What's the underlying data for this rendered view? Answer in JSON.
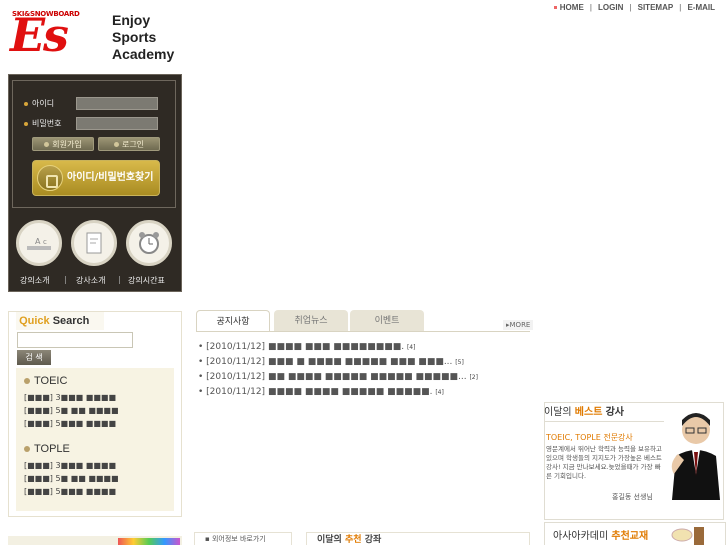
{
  "logo": {
    "sub": "SKI&SNOWBOARD",
    "mark": "Es",
    "line1": "Enjoy",
    "line2": "Sports",
    "line3": "Academy"
  },
  "topnav": [
    "HOME",
    "LOGIN",
    "SITEMAP",
    "E-MAIL"
  ],
  "login": {
    "id_label": "아이디",
    "pw_label": "비밀번호",
    "join_button": "회원가입",
    "login_button": "로그인",
    "find_button": "아이디/비밀번호찾기",
    "menu": [
      "강의소개",
      "강사소개",
      "강의시간표"
    ]
  },
  "quick_search": {
    "title_a": "Quick",
    "title_b": "Search",
    "button": "검 색",
    "categories": [
      {
        "name": "TOEIC",
        "items": [
          "[■■■] 3■■■ ■■■■",
          "[■■■] 5■ ■■ ■■■■",
          "[■■■] 5■■■ ■■■■"
        ]
      },
      {
        "name": "TOPLE",
        "items": [
          "[■■■] 3■■■ ■■■■",
          "[■■■] 5■ ■■ ■■■■",
          "[■■■] 5■■■ ■■■■"
        ]
      }
    ]
  },
  "notice": {
    "tabs": [
      "공지사항",
      "취업뉴스",
      "이벤트"
    ],
    "more": "MORE",
    "rows": [
      {
        "date": "[2010/11/12]",
        "text": "■■■■ ■■■ ■■■■■■■■.",
        "count": "[4]"
      },
      {
        "date": "[2010/11/12]",
        "text": "■■■ ■ ■■■■ ■■■■■ ■■■ ■■■...",
        "count": "[5]"
      },
      {
        "date": "[2010/11/12]",
        "text": "■■ ■■■■ ■■■■■ ■■■■■ ■■■■■...",
        "count": "[2]"
      },
      {
        "date": "[2010/11/12]",
        "text": "■■■■ ■■■■ ■■■■■ ■■■■■.",
        "count": "[4]"
      }
    ]
  },
  "teacher": {
    "head_a": "이달의",
    "head_b": "베스트",
    "head_c": "강사",
    "sub": "TOEIC, TOPLE 전문강사",
    "desc": "영문계에서 뛰어난 학력과 능력을 보유하고 있으며 학생들의 지지도가 가장높은 베스트 강사! 지금 만나보세요.늦었을때가 가장 빠른 기회입니다.",
    "name": "홍길동 선생님"
  },
  "book": {
    "head_a": "아사아카데미",
    "head_b": "추천교재"
  },
  "bottom": {
    "link": "외어정보 바로가기",
    "reco_a": "이달의",
    "reco_b": "추천",
    "reco_c": "강좌"
  }
}
